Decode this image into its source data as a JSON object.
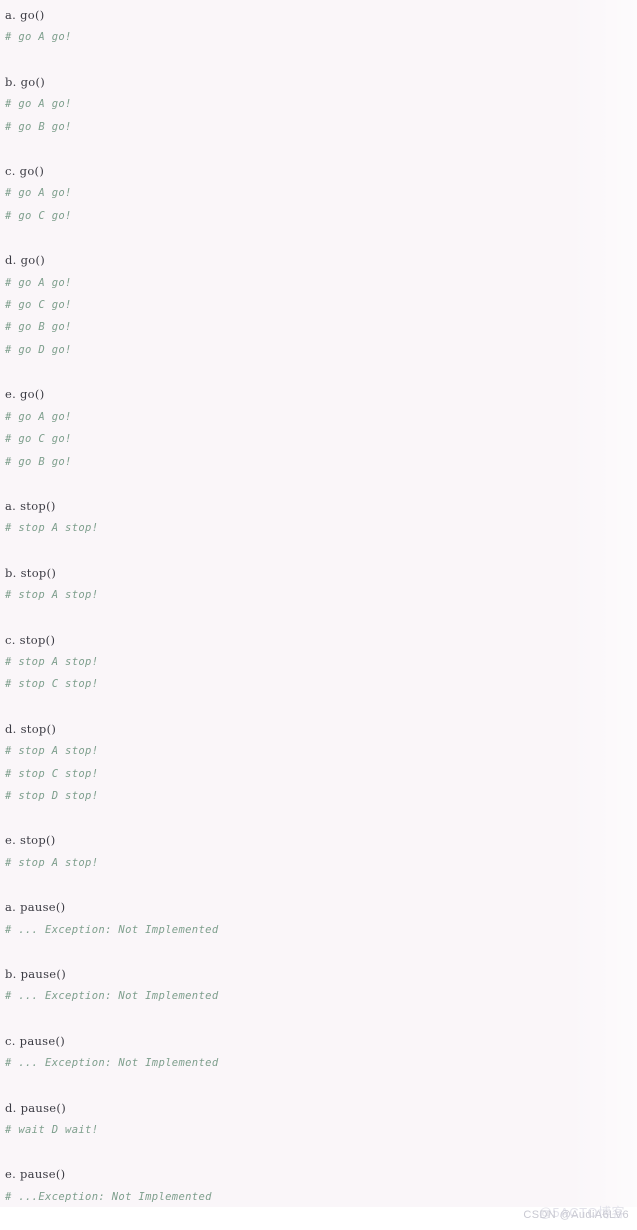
{
  "document": {
    "background_color": "#faf6f9",
    "comment_color": "#7e9f8d",
    "code_color": "#3a3a42"
  },
  "blocks": [
    {
      "call": "a. go()",
      "outputs": [
        "# go A go!"
      ]
    },
    {
      "call": "b. go()",
      "outputs": [
        "# go A go!",
        "# go B go!"
      ]
    },
    {
      "call": "c. go()",
      "outputs": [
        "# go A go!",
        "# go C go!"
      ]
    },
    {
      "call": "d. go()",
      "outputs": [
        "# go A go!",
        "# go C go!",
        "# go B go!",
        "# go D go!"
      ]
    },
    {
      "call": "e. go()",
      "outputs": [
        "# go A go!",
        "# go C go!",
        "# go B go!"
      ]
    },
    {
      "call": "a. stop()",
      "outputs": [
        "# stop A stop!"
      ]
    },
    {
      "call": "b. stop()",
      "outputs": [
        "# stop A stop!"
      ]
    },
    {
      "call": "c. stop()",
      "outputs": [
        "# stop A stop!",
        "# stop C stop!"
      ]
    },
    {
      "call": "d. stop()",
      "outputs": [
        "# stop A stop!",
        "# stop C stop!",
        "# stop D stop!"
      ]
    },
    {
      "call": "e. stop()",
      "outputs": [
        "# stop A stop!"
      ]
    },
    {
      "call": "a. pause()",
      "outputs": [
        "# ... Exception: Not Implemented"
      ]
    },
    {
      "call": "b. pause()",
      "outputs": [
        "# ... Exception: Not Implemented"
      ]
    },
    {
      "call": "c. pause()",
      "outputs": [
        "# ... Exception: Not Implemented"
      ]
    },
    {
      "call": "d. pause()",
      "outputs": [
        "# wait D wait!"
      ]
    },
    {
      "call": "e. pause()",
      "outputs": [
        "# ...Exception: Not Implemented"
      ]
    }
  ],
  "footer": {
    "watermark": "CSDN @AudiA6LV6",
    "watermark_ghost": "@5ACTO博客"
  }
}
